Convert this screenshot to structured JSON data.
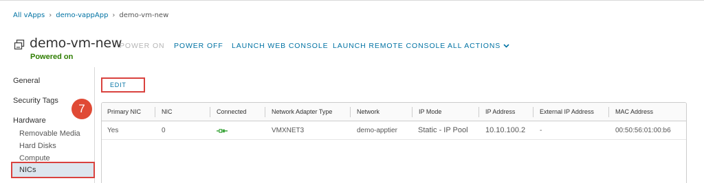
{
  "breadcrumb": {
    "items": [
      "All vApps",
      "demo-vappApp"
    ],
    "current": "demo-vm-new"
  },
  "vm": {
    "title": "demo-vm-new",
    "status": "Powered on",
    "status_color": "#2e7d00"
  },
  "actions": {
    "power_on": "POWER ON",
    "power_off": "POWER OFF",
    "launch_web_console": "LAUNCH WEB CONSOLE",
    "launch_remote_console": "LAUNCH REMOTE CONSOLE",
    "all_actions": "ALL ACTIONS"
  },
  "sidebar": {
    "general": "General",
    "security_tags": "Security Tags",
    "hardware": "Hardware",
    "removable_media": "Removable Media",
    "hard_disks": "Hard Disks",
    "compute": "Compute",
    "nics": "NICs"
  },
  "step_badge": "7",
  "edit_label": "EDIT",
  "table": {
    "columns": [
      "Primary NIC",
      "NIC",
      "Connected",
      "Network Adapter Type",
      "Network",
      "IP Mode",
      "IP Address",
      "External IP Address",
      "MAC Address"
    ],
    "rows": [
      {
        "primary_nic": "Yes",
        "nic": "0",
        "connected_icon": "connected-plug-icon",
        "adapter_type": "VMXNET3",
        "network": "demo-apptier",
        "ip_mode": "Static - IP Pool",
        "ip_address": "10.10.100.2",
        "external_ip": "-",
        "mac_address": "00:50:56:01:00:b6"
      }
    ]
  },
  "colors": {
    "link": "#0072a3",
    "highlight_border": "#d9413d",
    "badge": "#e04a35",
    "selected_bg": "#dde6ee",
    "connected": "#3fa63f"
  }
}
